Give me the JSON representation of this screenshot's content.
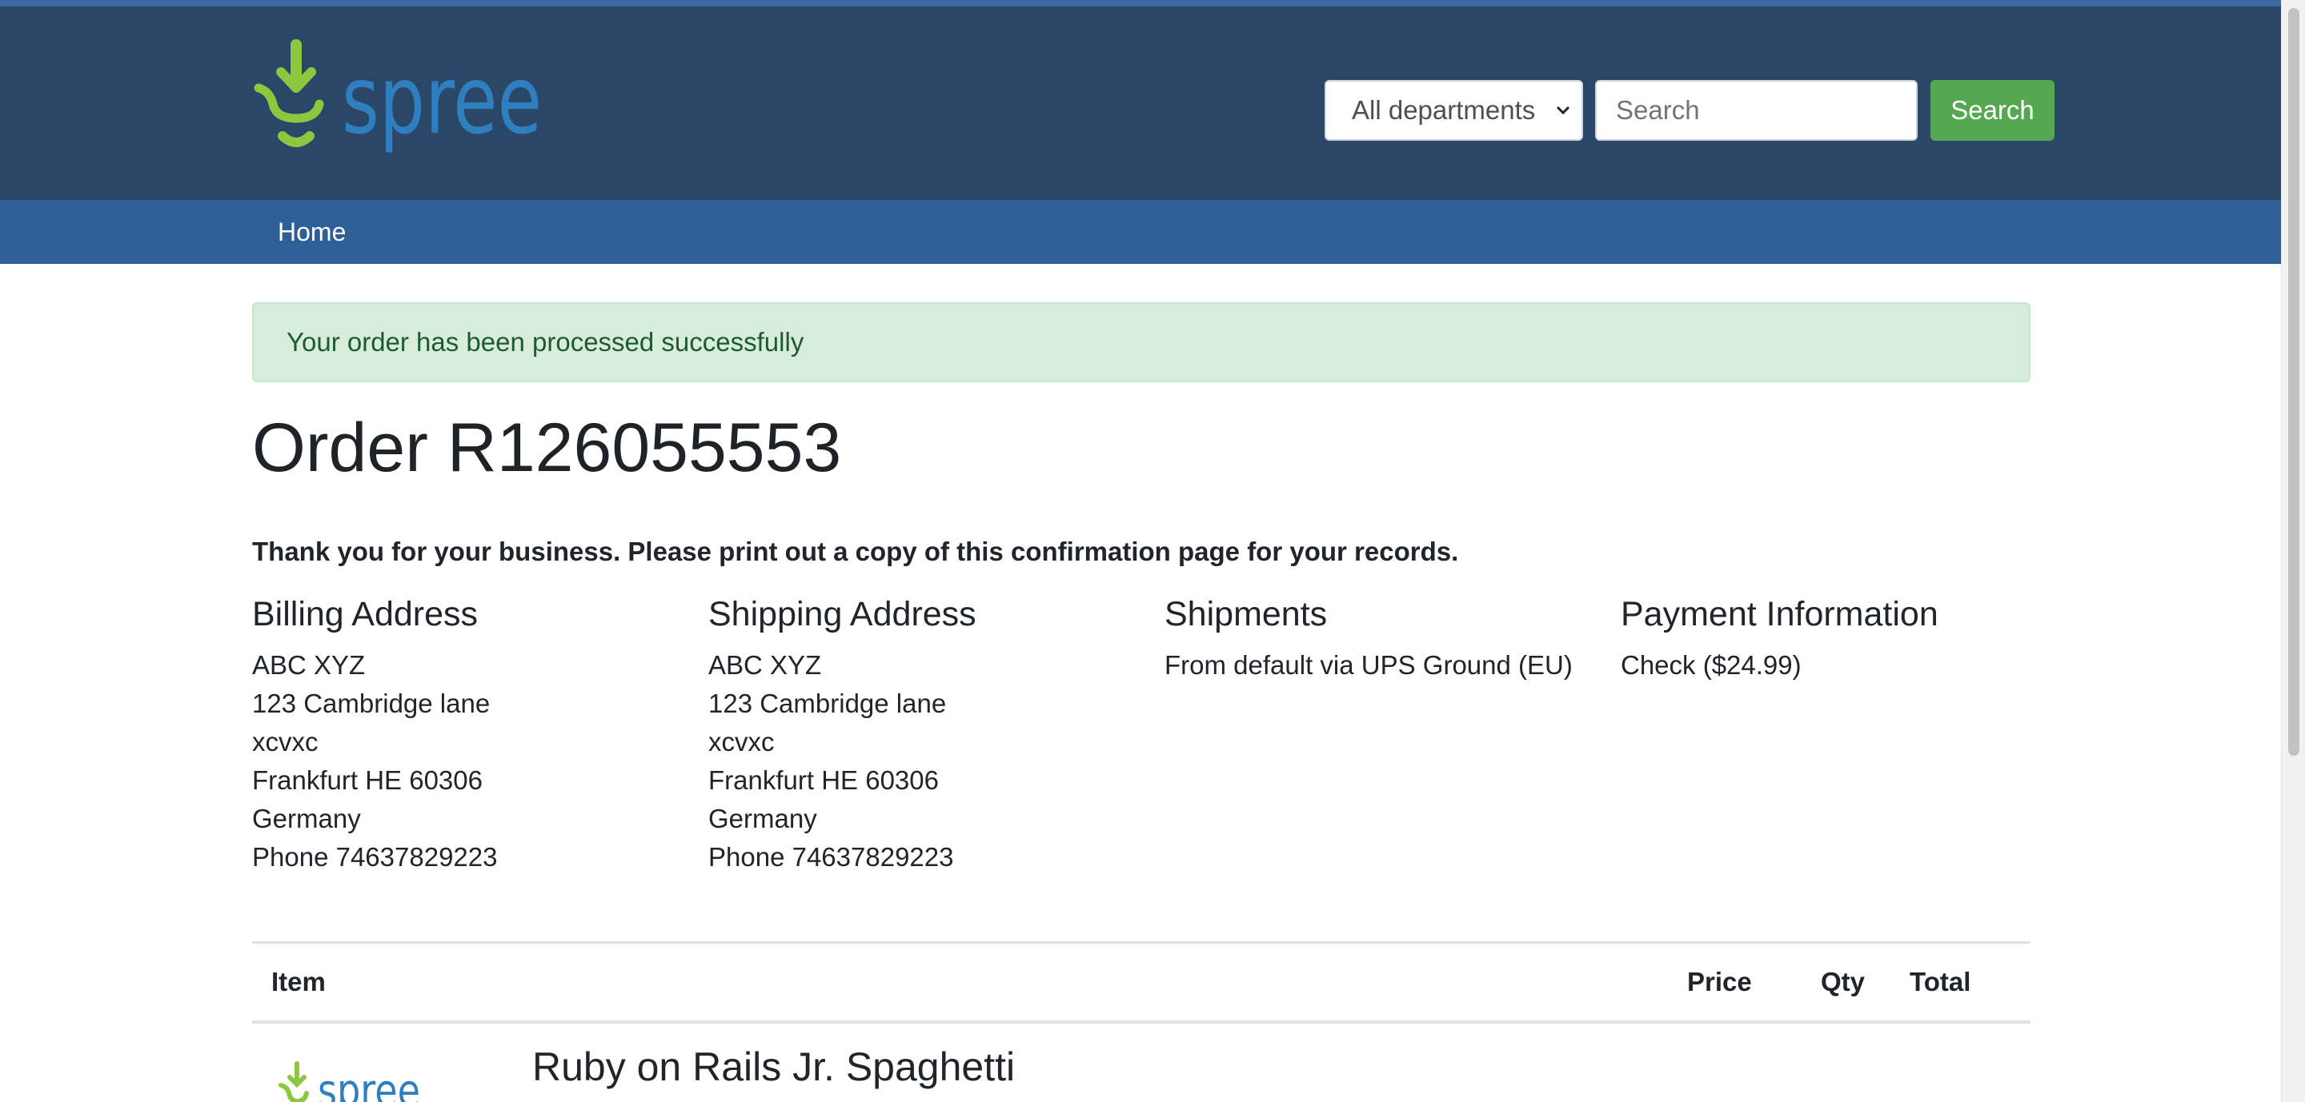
{
  "header": {
    "logo_text": "spree",
    "dept_select_value": "All departments",
    "search_placeholder": "Search",
    "search_button": "Search"
  },
  "nav": {
    "home": "Home"
  },
  "alert": "Your order has been processed successfully",
  "order": {
    "title": "Order R126055553",
    "thanks": "Thank you for your business. Please print out a copy of this confirmation page for your records."
  },
  "billing": {
    "heading": "Billing Address",
    "lines": [
      "ABC XYZ",
      "123 Cambridge lane",
      "xcvxc",
      "Frankfurt HE 60306",
      "Germany",
      "Phone 74637829223"
    ]
  },
  "shipping": {
    "heading": "Shipping Address",
    "lines": [
      "ABC XYZ",
      "123 Cambridge lane",
      "xcvxc",
      "Frankfurt HE 60306",
      "Germany",
      "Phone 74637829223"
    ]
  },
  "shipments": {
    "heading": "Shipments",
    "text": "From default via UPS Ground (EU)"
  },
  "payment": {
    "heading": "Payment Information",
    "text": "Check ($24.99)"
  },
  "table": {
    "headers": {
      "item": "Item",
      "price": "Price",
      "qty": "Qty",
      "total": "Total"
    },
    "rows": [
      {
        "name": "Ruby on Rails Jr. Spaghetti",
        "thumb_logo_text": "spree"
      }
    ]
  },
  "colors": {
    "header_bg": "#2b4767",
    "nav_bg": "#2e6097",
    "search_button": "#55a850",
    "alert_bg": "#d8ecdc",
    "logo_blue": "#2f7fc0",
    "logo_green": "#8dc63f"
  }
}
